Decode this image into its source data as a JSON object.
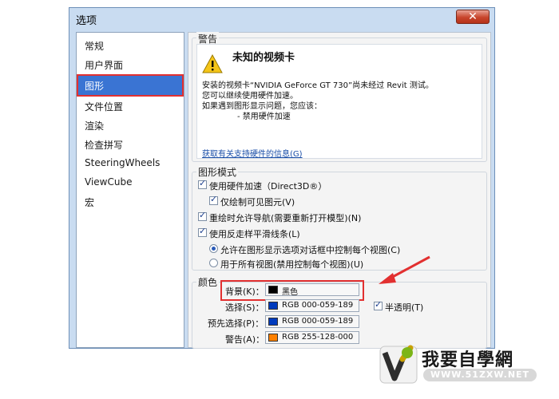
{
  "window": {
    "title": "选项",
    "close_label": "✕"
  },
  "sidebar": {
    "items": [
      {
        "label": "常规"
      },
      {
        "label": "用户界面"
      },
      {
        "label": "图形"
      },
      {
        "label": "文件位置"
      },
      {
        "label": "渲染"
      },
      {
        "label": "检查拼写"
      },
      {
        "label": "SteeringWheels"
      },
      {
        "label": "ViewCube"
      },
      {
        "label": "宏"
      }
    ],
    "selected": "图形"
  },
  "warning": {
    "group_title": "警告",
    "heading": "未知的视频卡",
    "line1": "安装的视频卡“NVIDIA GeForce GT 730”尚未经过 Revit 测试。",
    "line2": "您可以继续使用硬件加速。",
    "line3": "如果遇到图形显示问题，您应该：",
    "line4": "- 禁用硬件加速",
    "link": "获取有关支持硬件的信息(G)"
  },
  "graphics_mode": {
    "title": "图形模式",
    "hw_accel": "使用硬件加速（Direct3D®）",
    "visible_only": "仅绘制可见图元(V)",
    "nav_redraw": "重绘时允许导航(需要重新打开模型)(N)",
    "antialias": "使用反走样平滑线条(L)",
    "opt_per_view": "允许在图形显示选项对话框中控制每个视图(C)",
    "opt_all_views": "用于所有视图(禁用控制每个视图)(U)"
  },
  "colors": {
    "title": "颜色",
    "rows": [
      {
        "label": "背景(K)：",
        "value": "黑色",
        "hex": "#000000"
      },
      {
        "label": "选择(S)：",
        "value": "RGB 000-059-189",
        "hex": "#003bbd"
      },
      {
        "label": "预先选择(P)：",
        "value": "RGB 000-059-189",
        "hex": "#003bbd"
      },
      {
        "label": "警告(A)：",
        "value": "RGB 255-128-000",
        "hex": "#ff8000"
      }
    ],
    "semi_transparent": "半透明(T)"
  },
  "logo": {
    "text": "我要自學網",
    "url": "WWW.51ZXW.NET"
  }
}
